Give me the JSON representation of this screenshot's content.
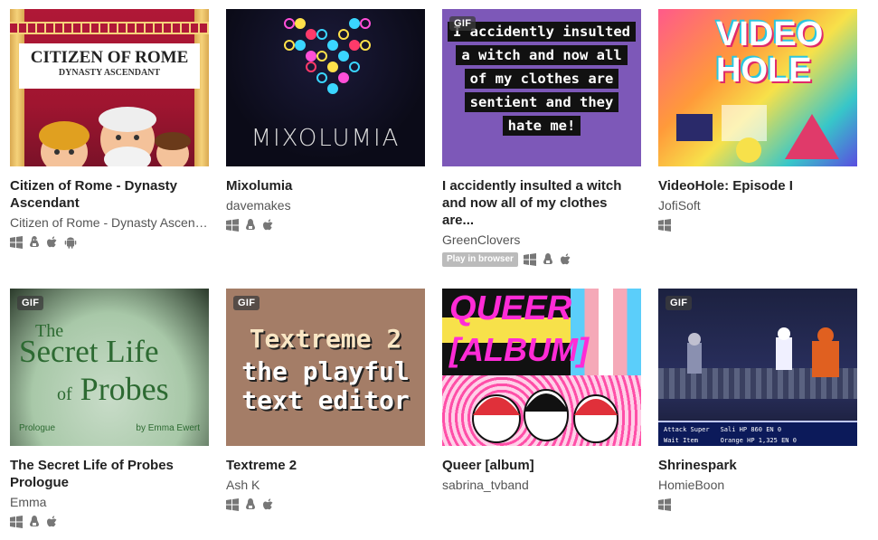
{
  "gif_label": "GIF",
  "games": [
    {
      "title": "Citizen of Rome - Dynasty Ascendant",
      "author": "Citizen of Rome - Dynasty Ascend...",
      "gif": false,
      "thumb_text": [
        "CITIZEN OF ROME",
        "DYNASTY ASCENDANT"
      ],
      "platforms": [
        "windows-icon",
        "linux-icon",
        "apple-icon",
        "android-icon"
      ]
    },
    {
      "title": "Mixolumia",
      "author": "davemakes",
      "gif": false,
      "thumb_text": [
        "MIXOLUMIA"
      ],
      "platforms": [
        "windows-icon",
        "linux-icon",
        "apple-icon"
      ]
    },
    {
      "title": "I accidently insulted a witch and now all of my clothes are...",
      "author": "GreenClovers",
      "gif": true,
      "thumb_text": [
        "I accidently insulted",
        "a witch and now all",
        "of my clothes are",
        "sentient and they",
        "hate me!"
      ],
      "browser_badge": "Play in browser",
      "platforms": [
        "windows-icon",
        "linux-icon",
        "apple-icon"
      ]
    },
    {
      "title": "VideoHole: Episode I",
      "author": "JofiSoft",
      "gif": false,
      "thumb_text": [
        "VIDEO",
        "HOLE"
      ],
      "platforms": [
        "windows-icon"
      ]
    },
    {
      "title": "The Secret Life of Probes Prologue",
      "author": "Emma",
      "gif": true,
      "thumb_text": [
        "The",
        "Secret Life",
        "of",
        "Probes",
        "Prologue",
        "by Emma Ewert"
      ],
      "platforms": [
        "windows-icon",
        "linux-icon",
        "apple-icon"
      ]
    },
    {
      "title": "Textreme 2",
      "author": "Ash K",
      "gif": true,
      "thumb_text": [
        "Textreme 2",
        "the playful",
        "text editor"
      ],
      "platforms": [
        "windows-icon",
        "linux-icon",
        "apple-icon"
      ]
    },
    {
      "title": "Queer [album]",
      "author": "sabrina_tvband",
      "gif": false,
      "thumb_text": [
        "QUEER",
        "[ALBUM]"
      ],
      "platforms": []
    },
    {
      "title": "Shrinespark",
      "author": "HomieBoon",
      "gif": true,
      "thumb_text": [
        "Attack",
        "Super",
        "Wait",
        "Item",
        "Sali",
        "Orange",
        "HP",
        "860",
        "1,325",
        "EN",
        "0"
      ],
      "platforms": [
        "windows-icon"
      ]
    }
  ]
}
